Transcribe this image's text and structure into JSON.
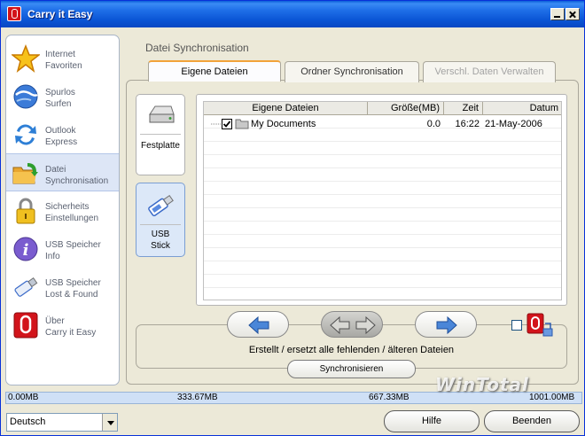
{
  "window": {
    "title": "Carry it Easy"
  },
  "sidebar": {
    "items": [
      {
        "line1": "Internet",
        "line2": "Favoriten"
      },
      {
        "line1": "Spurlos",
        "line2": "Surfen"
      },
      {
        "line1": "Outlook",
        "line2": "Express"
      },
      {
        "line1": "Datei",
        "line2": "Synchronisation"
      },
      {
        "line1": "Sicherheits",
        "line2": "Einstellungen"
      },
      {
        "line1": "USB Speicher",
        "line2": "Info"
      },
      {
        "line1": "USB Speicher",
        "line2": "Lost & Found"
      },
      {
        "line1": "Über",
        "line2": "Carry it Easy"
      }
    ],
    "active_index": 3
  },
  "main": {
    "section_title": "Datei Synchronisation",
    "tabs": [
      "Eigene Dateien",
      "Ordner Synchronisation",
      "Verschl. Daten Verwalten"
    ],
    "devices": {
      "hdd": "Festplatte",
      "usb_line1": "USB",
      "usb_line2": "Stick"
    },
    "table": {
      "columns": [
        "Eigene Dateien",
        "Größe(MB)",
        "Zeit",
        "Datum"
      ],
      "rows": [
        {
          "name": "My Documents",
          "size": "0.0",
          "time": "16:22",
          "date": "21-May-2006",
          "checked": true
        }
      ]
    },
    "sync_description": "Erstellt / ersetzt alle fehlenden / älteren Dateien",
    "sync_button": "Synchronisieren"
  },
  "storage": {
    "labels": [
      "0.00MB",
      "333.67MB",
      "667.33MB",
      "1001.00MB"
    ],
    "used_fraction": 0.0
  },
  "watermark": "WinTotal",
  "footer": {
    "language": "Deutsch",
    "help_button": "Hilfe",
    "exit_button": "Beenden"
  }
}
